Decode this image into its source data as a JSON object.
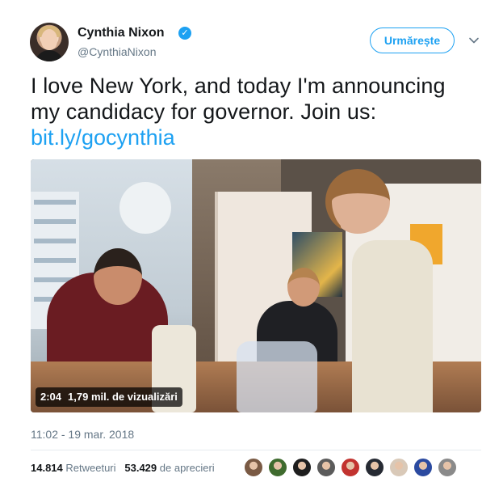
{
  "user": {
    "name": "Cynthia Nixon",
    "handle": "@CynthiaNixon",
    "verified_icon": "verified-badge-icon"
  },
  "header": {
    "follow_label": "Urmărește",
    "menu_icon": "chevron-down-icon"
  },
  "tweet": {
    "text_lines": [
      "I love New York, and today I'm announcing",
      "my candidacy for governor. Join us:"
    ],
    "link": "bit.ly/gocynthia"
  },
  "video": {
    "duration": "2:04",
    "views": "1,79 mil. de vizualizări"
  },
  "timestamp": "11:02 - 19 mar. 2018",
  "stats": {
    "retweets_count": "14.814",
    "retweets_label": "Retweeturi",
    "likes_count": "53.429",
    "likes_label": "de aprecieri"
  },
  "likers": {
    "count": 9,
    "colors": [
      "#7a5a44",
      "#3f6b2e",
      "#1e1e1e",
      "#5b5b5b",
      "#c2332f",
      "#262a33",
      "#d9c9b8",
      "#2b4aa0",
      "#8a8a8a"
    ]
  },
  "colors": {
    "accent": "#1da1f2",
    "text": "#14171a",
    "muted": "#657786"
  }
}
